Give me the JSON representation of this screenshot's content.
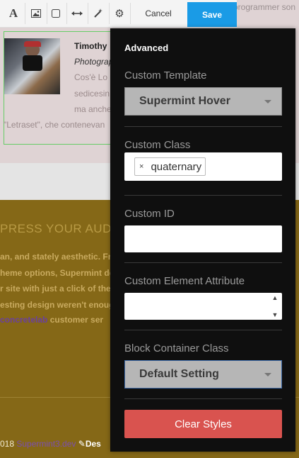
{
  "background": {
    "top_faint_text": "programmer son",
    "profile": {
      "name": "Timothy",
      "role": "Photograp",
      "lines": [
        "Cos'è Lo",
        "sedicesin",
        "ma anche",
        "\"Letraset\", che contenevan"
      ]
    },
    "gold": {
      "title": "PRESS YOUR AUDIE",
      "lines": [
        "an, and stately aesthetic. Fr",
        "heme options, Supermint de",
        "r site with just a click of the",
        "esting design weren't enoug"
      ],
      "last_line_link": "concretelab",
      "last_line_rest": " customer ser"
    },
    "footer": {
      "year": "018 ",
      "link": "Supermint3.dev",
      "icon": "magic-wand-icon",
      "rest": "Des"
    }
  },
  "toolbar": {
    "icons": [
      "font-icon",
      "image-icon",
      "border-icon",
      "width-icon",
      "magic-wand-icon",
      "gear-icon"
    ],
    "cancel_label": "Cancel",
    "save_label": "Save",
    "save_color": "#1a9be6"
  },
  "panel": {
    "title": "Advanced",
    "custom_template": {
      "label": "Custom Template",
      "value": "Supermint Hover"
    },
    "custom_class": {
      "label": "Custom Class",
      "tag_remove": "×",
      "tag": "quaternary"
    },
    "custom_id": {
      "label": "Custom ID",
      "value": ""
    },
    "custom_attribute": {
      "label": "Custom Element Attribute",
      "value": ""
    },
    "block_container": {
      "label": "Block Container Class",
      "value": "Default Setting"
    },
    "clear_label": "Clear Styles",
    "clear_color": "#d9534f"
  }
}
